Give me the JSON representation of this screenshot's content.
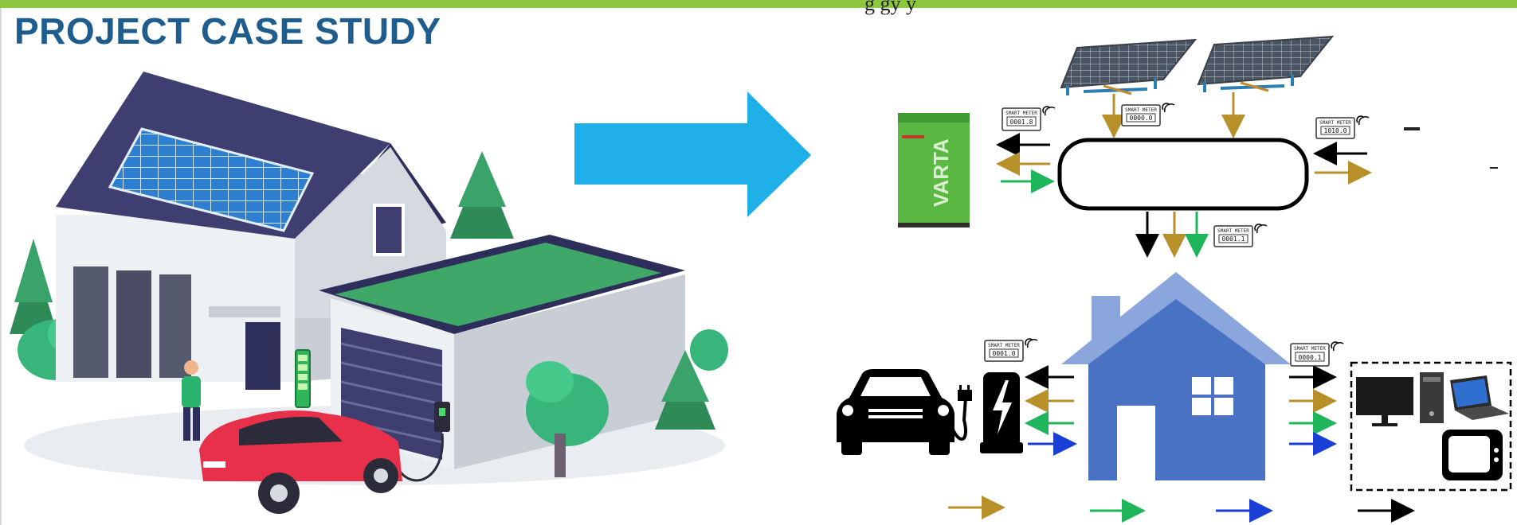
{
  "header": {
    "title": "PROJECT CASE STUDY",
    "cutoff_text": "g  gy  y"
  },
  "colors": {
    "top_bar": "#8dc63f",
    "title": "#1f5d8f",
    "big_arrow": "#1fb0ea",
    "house": "#4a72c4",
    "house_roof": "#8aa6dc",
    "flow_black": "#000000",
    "flow_gold": "#b8902a",
    "flow_green": "#1fb55a",
    "flow_blue": "#1a3fd6",
    "battery": "#5ab843",
    "car_illustration": "#e8304a"
  },
  "illustration": {
    "house_scene": "house-with-solar-roof-and-ev-charging-illustration"
  },
  "battery": {
    "brand": "VARTA"
  },
  "meters": [
    {
      "label": "SMART METER",
      "reading": "0001.8"
    },
    {
      "label": "SMART METER",
      "reading": "0000.0"
    },
    {
      "label": "SMART METER",
      "reading": "1010.0"
    },
    {
      "label": "SMART METER",
      "reading": "0001.1"
    },
    {
      "label": "SMART METER",
      "reading": "0001.0"
    },
    {
      "label": "SMART METER",
      "reading": "0000.1"
    }
  ],
  "icons": {
    "solar_panel": "solar-panel-icon",
    "battery": "varta-battery-icon",
    "inverter_hub": "energy-hub-icon",
    "home": "home-icon",
    "car": "car-icon",
    "charger": "ev-charger-icon",
    "devices": [
      "monitor-icon",
      "pc-tower-icon",
      "laptop-icon",
      "tv-icon"
    ]
  }
}
